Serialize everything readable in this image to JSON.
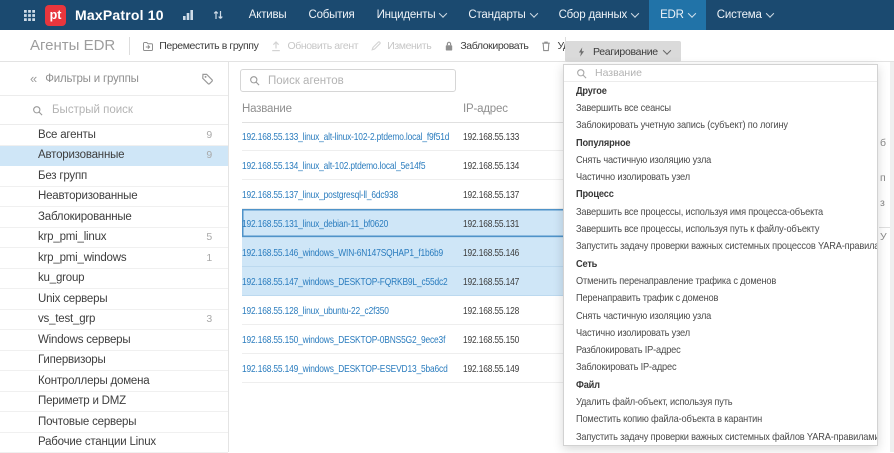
{
  "colors": {
    "navbar_bg": "#1b4a70",
    "navbar_active_bg": "#2173a8",
    "logo_red": "#e8363d",
    "link_blue": "#2a7cbe",
    "selection_blue": "#cfe6f7",
    "focus_border_blue": "#4f93c9"
  },
  "navbar": {
    "logo": "pt",
    "brand": "MaxPatrol 10",
    "menu": [
      {
        "label": "Активы",
        "dropdown": false,
        "active": false
      },
      {
        "label": "События",
        "dropdown": false,
        "active": false
      },
      {
        "label": "Инциденты",
        "dropdown": true,
        "active": false
      },
      {
        "label": "Стандарты",
        "dropdown": true,
        "active": false
      },
      {
        "label": "Сбор данных",
        "dropdown": true,
        "active": false
      },
      {
        "label": "EDR",
        "dropdown": true,
        "active": true
      },
      {
        "label": "Система",
        "dropdown": true,
        "active": false
      }
    ]
  },
  "toolbar": {
    "title": "Агенты EDR",
    "buttons": [
      {
        "label": "Переместить в группу",
        "icon": "move-to-group-icon",
        "disabled": false
      },
      {
        "label": "Обновить агент",
        "icon": "update-agent-icon",
        "disabled": true
      },
      {
        "label": "Изменить",
        "icon": "edit-icon",
        "disabled": true
      },
      {
        "label": "Заблокировать",
        "icon": "lock-icon",
        "disabled": false
      },
      {
        "label": "Удалить",
        "icon": "trash-icon",
        "disabled": false
      }
    ],
    "response_button": {
      "label": "Реагирование",
      "icon": "lightning-icon",
      "open": true
    }
  },
  "sidebar": {
    "title": "Фильтры и группы",
    "search_placeholder": "Быстрый поиск",
    "items": [
      {
        "label": "Все агенты",
        "count": "9",
        "selected": false
      },
      {
        "label": "Авторизованные",
        "count": "9",
        "selected": true
      },
      {
        "label": "Без групп",
        "count": "",
        "selected": false
      },
      {
        "label": "Неавторизованные",
        "count": "",
        "selected": false
      },
      {
        "label": "Заблокированные",
        "count": "",
        "selected": false
      },
      {
        "label": "krp_pmi_linux",
        "count": "5",
        "selected": false
      },
      {
        "label": "krp_pmi_windows",
        "count": "1",
        "selected": false
      },
      {
        "label": "ku_group",
        "count": "",
        "selected": false
      },
      {
        "label": "Unix серверы",
        "count": "",
        "selected": false
      },
      {
        "label": "vs_test_grp",
        "count": "3",
        "selected": false
      },
      {
        "label": "Windows серверы",
        "count": "",
        "selected": false
      },
      {
        "label": "Гипервизоры",
        "count": "",
        "selected": false
      },
      {
        "label": "Контроллеры домена",
        "count": "",
        "selected": false
      },
      {
        "label": "Периметр и DMZ",
        "count": "",
        "selected": false
      },
      {
        "label": "Почтовые серверы",
        "count": "",
        "selected": false
      },
      {
        "label": "Рабочие станции Linux",
        "count": "",
        "selected": false
      }
    ]
  },
  "agents": {
    "search_placeholder": "Поиск агентов",
    "columns": [
      "Название",
      "IP-адрес"
    ],
    "rows": [
      {
        "name": "192.168.55.133_linux_alt-linux-102-2.ptdemo.local_f9f51d",
        "ip": "192.168.55.133",
        "selected": false,
        "focused": false
      },
      {
        "name": "192.168.55.134_linux_alt-102.ptdemo.local_5e14f5",
        "ip": "192.168.55.134",
        "selected": false,
        "focused": false
      },
      {
        "name": "192.168.55.137_linux_postgresql-ll_6dc938",
        "ip": "192.168.55.137",
        "selected": false,
        "focused": false
      },
      {
        "name": "192.168.55.131_linux_debian-11_bf0620",
        "ip": "192.168.55.131",
        "selected": true,
        "focused": true
      },
      {
        "name": "192.168.55.146_windows_WIN-6N147SQHAP1_f1b6b9",
        "ip": "192.168.55.146",
        "selected": true,
        "focused": false
      },
      {
        "name": "192.168.55.147_windows_DESKTOP-FQRKB9L_c55dc2",
        "ip": "192.168.55.147",
        "selected": true,
        "focused": false
      },
      {
        "name": "192.168.55.128_linux_ubuntu-22_c2f350",
        "ip": "192.168.55.128",
        "selected": false,
        "focused": false
      },
      {
        "name": "192.168.55.150_windows_DESKTOP-0BNS5G2_9ece3f",
        "ip": "192.168.55.150",
        "selected": false,
        "focused": false
      },
      {
        "name": "192.168.55.149_windows_DESKTOP-ESEVD13_5ba6cd",
        "ip": "192.168.55.149",
        "selected": false,
        "focused": false
      }
    ]
  },
  "response_menu": {
    "search_placeholder": "Название",
    "entries": [
      {
        "type": "group",
        "label": "Другое"
      },
      {
        "type": "action",
        "label": "Завершить все сеансы"
      },
      {
        "type": "action",
        "label": "Заблокировать учетную запись (субъект) по логину"
      },
      {
        "type": "group",
        "label": "Популярное"
      },
      {
        "type": "action",
        "label": "Снять частичную изоляцию узла"
      },
      {
        "type": "action",
        "label": "Частично изолировать узел"
      },
      {
        "type": "group",
        "label": "Процесс"
      },
      {
        "type": "action",
        "label": "Завершить все процессы, используя имя процесса-объекта"
      },
      {
        "type": "action",
        "label": "Завершить все процессы, используя путь к файлу-объекту"
      },
      {
        "type": "action",
        "label": "Запустить задачу проверки важных системных процессов YARA-правилами"
      },
      {
        "type": "group",
        "label": "Сеть"
      },
      {
        "type": "action",
        "label": "Отменить перенаправление трафика с доменов"
      },
      {
        "type": "action",
        "label": "Перенаправить трафик с доменов"
      },
      {
        "type": "action",
        "label": "Снять частичную изоляцию узла"
      },
      {
        "type": "action",
        "label": "Частично изолировать узел"
      },
      {
        "type": "action",
        "label": "Разблокировать IP-адрес"
      },
      {
        "type": "action",
        "label": "Заблокировать IP-адрес"
      },
      {
        "type": "group",
        "label": "Файл"
      },
      {
        "type": "action",
        "label": "Удалить файл-объект, используя путь"
      },
      {
        "type": "action",
        "label": "Поместить копию файла-объекта в карантин"
      },
      {
        "type": "action",
        "label": "Запустить задачу проверки важных системных файлов YARA-правилами"
      }
    ]
  },
  "background_fragments": {
    "letters": [
      "б",
      "п",
      "з",
      "У"
    ]
  }
}
